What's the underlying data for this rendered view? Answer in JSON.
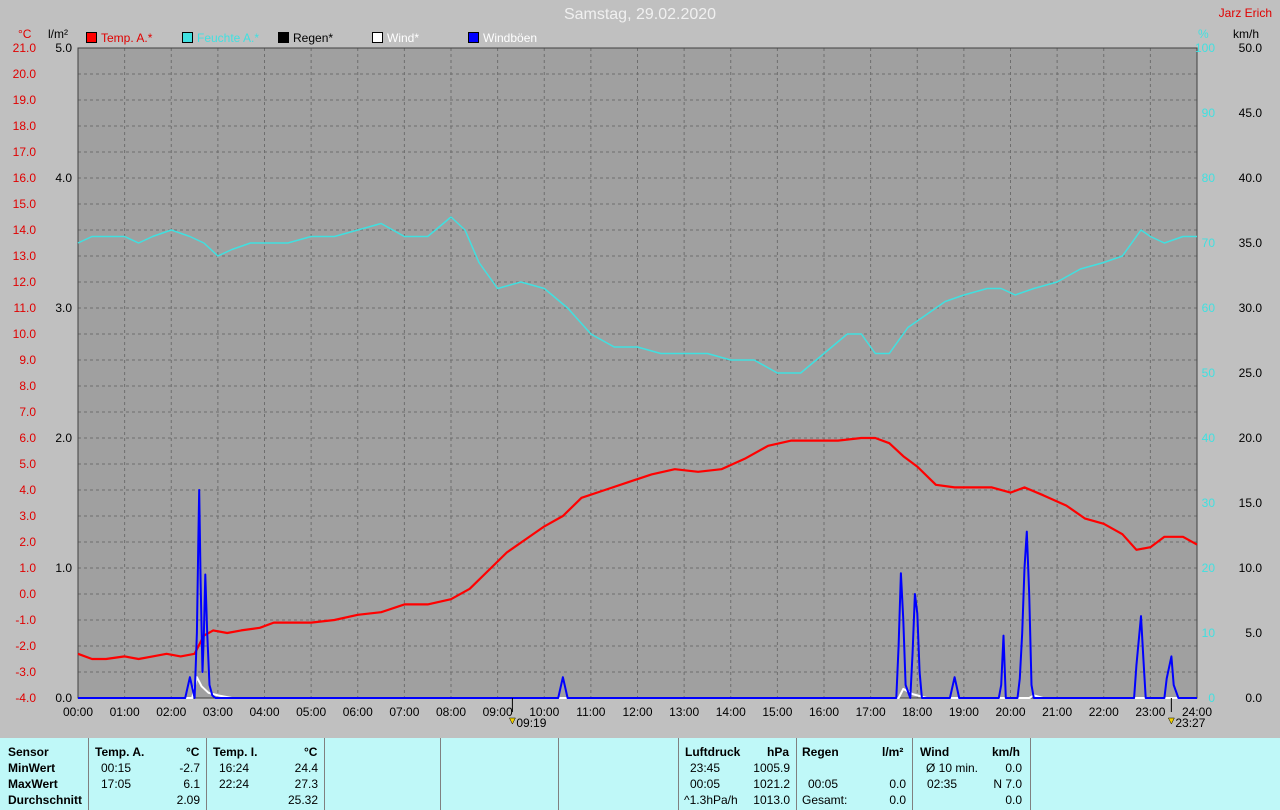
{
  "title": "Samstag, 29.02.2020",
  "author": "Jarz Erich",
  "legend": [
    {
      "label": "Temp. A.*",
      "color": "#ff0000"
    },
    {
      "label": "Feuchte A.*",
      "color": "#40e0e0"
    },
    {
      "label": "Regen*",
      "color": "#000000"
    },
    {
      "label": "Wind*",
      "color": "#ffffff"
    },
    {
      "label": "Windböen",
      "color": "#0000ff"
    }
  ],
  "units": {
    "temp": "°C",
    "rain": "l/m²",
    "hum": "%",
    "wind": "km/h"
  },
  "markers": {
    "sunrise": "09:19",
    "sunset": "23:27"
  },
  "chart_data": {
    "type": "line",
    "x_ticks": [
      "00:00",
      "01:00",
      "02:00",
      "03:00",
      "04:00",
      "05:00",
      "06:00",
      "07:00",
      "08:00",
      "09:00",
      "10:00",
      "11:00",
      "12:00",
      "13:00",
      "14:00",
      "15:00",
      "16:00",
      "17:00",
      "18:00",
      "19:00",
      "20:00",
      "21:00",
      "22:00",
      "23:00",
      "24:00"
    ],
    "axes": {
      "temp": {
        "min": -4,
        "max": 21,
        "step": 1
      },
      "rain": {
        "min": 0,
        "max": 5,
        "step": 1
      },
      "hum": {
        "min": 0,
        "max": 100,
        "step": 10
      },
      "wind": {
        "min": 0,
        "max": 50,
        "step": 5
      }
    },
    "series": [
      {
        "name": "Temp. A.*",
        "axis": "temp",
        "color": "#ff0000",
        "points": [
          [
            0.0,
            -2.3
          ],
          [
            0.3,
            -2.5
          ],
          [
            0.6,
            -2.5
          ],
          [
            1.0,
            -2.4
          ],
          [
            1.3,
            -2.5
          ],
          [
            1.6,
            -2.4
          ],
          [
            1.9,
            -2.3
          ],
          [
            2.2,
            -2.4
          ],
          [
            2.5,
            -2.3
          ],
          [
            2.7,
            -1.6
          ],
          [
            2.9,
            -1.4
          ],
          [
            3.2,
            -1.5
          ],
          [
            3.5,
            -1.4
          ],
          [
            3.9,
            -1.3
          ],
          [
            4.2,
            -1.1
          ],
          [
            4.6,
            -1.1
          ],
          [
            5.0,
            -1.1
          ],
          [
            5.5,
            -1.0
          ],
          [
            6.0,
            -0.8
          ],
          [
            6.5,
            -0.7
          ],
          [
            7.0,
            -0.4
          ],
          [
            7.5,
            -0.4
          ],
          [
            8.0,
            -0.2
          ],
          [
            8.4,
            0.2
          ],
          [
            8.8,
            0.9
          ],
          [
            9.2,
            1.6
          ],
          [
            9.6,
            2.1
          ],
          [
            10.0,
            2.6
          ],
          [
            10.4,
            3.0
          ],
          [
            10.8,
            3.7
          ],
          [
            11.3,
            4.0
          ],
          [
            11.8,
            4.3
          ],
          [
            12.3,
            4.6
          ],
          [
            12.8,
            4.8
          ],
          [
            13.3,
            4.7
          ],
          [
            13.8,
            4.8
          ],
          [
            14.3,
            5.2
          ],
          [
            14.8,
            5.7
          ],
          [
            15.3,
            5.9
          ],
          [
            15.8,
            5.9
          ],
          [
            16.3,
            5.9
          ],
          [
            16.8,
            6.0
          ],
          [
            17.1,
            6.0
          ],
          [
            17.4,
            5.8
          ],
          [
            17.7,
            5.3
          ],
          [
            18.0,
            4.9
          ],
          [
            18.4,
            4.2
          ],
          [
            18.8,
            4.1
          ],
          [
            19.2,
            4.1
          ],
          [
            19.6,
            4.1
          ],
          [
            20.0,
            3.9
          ],
          [
            20.3,
            4.1
          ],
          [
            20.7,
            3.8
          ],
          [
            21.2,
            3.4
          ],
          [
            21.6,
            2.9
          ],
          [
            22.0,
            2.7
          ],
          [
            22.4,
            2.3
          ],
          [
            22.7,
            1.7
          ],
          [
            23.0,
            1.8
          ],
          [
            23.3,
            2.2
          ],
          [
            23.7,
            2.2
          ],
          [
            24.0,
            1.9
          ]
        ]
      },
      {
        "name": "Feuchte A.*",
        "axis": "hum",
        "color": "#40e0e0",
        "points": [
          [
            0.0,
            70
          ],
          [
            0.3,
            71
          ],
          [
            0.6,
            71
          ],
          [
            1.0,
            71
          ],
          [
            1.3,
            70
          ],
          [
            1.6,
            71
          ],
          [
            2.0,
            72
          ],
          [
            2.4,
            71
          ],
          [
            2.7,
            70
          ],
          [
            3.0,
            68
          ],
          [
            3.3,
            69
          ],
          [
            3.7,
            70
          ],
          [
            4.0,
            70
          ],
          [
            4.5,
            70
          ],
          [
            5.0,
            71
          ],
          [
            5.5,
            71
          ],
          [
            6.0,
            72
          ],
          [
            6.5,
            73
          ],
          [
            7.0,
            71
          ],
          [
            7.5,
            71
          ],
          [
            8.0,
            74
          ],
          [
            8.3,
            72
          ],
          [
            8.6,
            67
          ],
          [
            9.0,
            63
          ],
          [
            9.5,
            64
          ],
          [
            10.0,
            63
          ],
          [
            10.5,
            60
          ],
          [
            11.0,
            56
          ],
          [
            11.5,
            54
          ],
          [
            12.0,
            54
          ],
          [
            12.5,
            53
          ],
          [
            13.0,
            53
          ],
          [
            13.5,
            53
          ],
          [
            14.0,
            52
          ],
          [
            14.5,
            52
          ],
          [
            15.0,
            50
          ],
          [
            15.5,
            50
          ],
          [
            16.0,
            53
          ],
          [
            16.5,
            56
          ],
          [
            16.8,
            56
          ],
          [
            17.1,
            53
          ],
          [
            17.4,
            53
          ],
          [
            17.8,
            57
          ],
          [
            18.2,
            59
          ],
          [
            18.6,
            61
          ],
          [
            19.0,
            62
          ],
          [
            19.5,
            63
          ],
          [
            19.8,
            63
          ],
          [
            20.1,
            62
          ],
          [
            20.5,
            63
          ],
          [
            21.0,
            64
          ],
          [
            21.5,
            66
          ],
          [
            22.0,
            67
          ],
          [
            22.4,
            68
          ],
          [
            22.8,
            72
          ],
          [
            23.0,
            71
          ],
          [
            23.3,
            70
          ],
          [
            23.7,
            71
          ],
          [
            24.0,
            71
          ]
        ]
      },
      {
        "name": "Wind*",
        "axis": "wind",
        "color": "#ffffff",
        "points": [
          [
            0.0,
            0
          ],
          [
            2.45,
            0
          ],
          [
            2.55,
            1.6
          ],
          [
            2.65,
            0.9
          ],
          [
            2.8,
            0.4
          ],
          [
            3.0,
            0.2
          ],
          [
            3.3,
            0
          ],
          [
            17.6,
            0
          ],
          [
            17.7,
            0.7
          ],
          [
            17.9,
            0.3
          ],
          [
            18.2,
            0
          ],
          [
            20.4,
            0
          ],
          [
            20.5,
            0.2
          ],
          [
            20.7,
            0
          ],
          [
            24.0,
            0
          ]
        ]
      },
      {
        "name": "Windböen",
        "axis": "wind",
        "color": "#0000ff",
        "points": [
          [
            0.0,
            0
          ],
          [
            2.3,
            0
          ],
          [
            2.4,
            1.6
          ],
          [
            2.5,
            0
          ],
          [
            2.55,
            5.0
          ],
          [
            2.58,
            12.0
          ],
          [
            2.6,
            16.0
          ],
          [
            2.63,
            9.0
          ],
          [
            2.67,
            2.0
          ],
          [
            2.7,
            5.0
          ],
          [
            2.73,
            9.5
          ],
          [
            2.77,
            5.0
          ],
          [
            2.82,
            1.0
          ],
          [
            2.88,
            0.2
          ],
          [
            2.95,
            0
          ],
          [
            10.3,
            0
          ],
          [
            10.4,
            1.6
          ],
          [
            10.5,
            0
          ],
          [
            17.55,
            0
          ],
          [
            17.6,
            4.0
          ],
          [
            17.65,
            9.6
          ],
          [
            17.7,
            6.0
          ],
          [
            17.75,
            1.0
          ],
          [
            17.85,
            0
          ],
          [
            17.9,
            3.5
          ],
          [
            17.95,
            8.0
          ],
          [
            18.0,
            6.5
          ],
          [
            18.05,
            2.0
          ],
          [
            18.1,
            0
          ],
          [
            18.7,
            0
          ],
          [
            18.8,
            1.6
          ],
          [
            18.9,
            0
          ],
          [
            19.75,
            0
          ],
          [
            19.8,
            1.0
          ],
          [
            19.85,
            4.8
          ],
          [
            19.9,
            0
          ],
          [
            20.15,
            0
          ],
          [
            20.2,
            1.5
          ],
          [
            20.25,
            5.0
          ],
          [
            20.3,
            10.0
          ],
          [
            20.35,
            12.8
          ],
          [
            20.4,
            8.0
          ],
          [
            20.45,
            1.0
          ],
          [
            20.5,
            0
          ],
          [
            22.65,
            0
          ],
          [
            22.7,
            2.5
          ],
          [
            22.8,
            6.3
          ],
          [
            22.85,
            3.0
          ],
          [
            22.9,
            0
          ],
          [
            23.3,
            0
          ],
          [
            23.35,
            1.5
          ],
          [
            23.45,
            3.2
          ],
          [
            23.5,
            1.0
          ],
          [
            23.6,
            0
          ],
          [
            24.0,
            0
          ]
        ]
      }
    ]
  },
  "summary": {
    "header": {
      "sensor": "Sensor",
      "tempa": "Temp. A.",
      "tempa_unit": "°C",
      "tempi": "Temp. I.",
      "tempi_unit": "°C",
      "pressure": "Luftdruck",
      "pressure_unit": "hPa",
      "rain": "Regen",
      "rain_unit": "l/m²",
      "wind": "Wind",
      "wind_unit": "km/h"
    },
    "rows": [
      {
        "label": "MinWert",
        "tempa_t": "00:15",
        "tempa_v": "-2.7",
        "tempi_t": "16:24",
        "tempi_v": "24.4",
        "press_t": "23:45",
        "press_v": "1005.9",
        "rain_t": "",
        "rain_v": "",
        "wind_t": "Ø 10 min.",
        "wind_v": "0.0"
      },
      {
        "label": "MaxWert",
        "tempa_t": "17:05",
        "tempa_v": "6.1",
        "tempi_t": "22:24",
        "tempi_v": "27.3",
        "press_t": "00:05",
        "press_v": "1021.2",
        "rain_t": "00:05",
        "rain_v": "0.0",
        "wind_t": "02:35",
        "wind_v": "N 7.0"
      },
      {
        "label": "Durchschnitt",
        "tempa_t": "",
        "tempa_v": "2.09",
        "tempi_t": "",
        "tempi_v": "25.32",
        "press_t": "^1.3hPa/h",
        "press_v": "1013.0",
        "rain_t": "Gesamt:",
        "rain_v": "0.0",
        "wind_t": "",
        "wind_v": "0.0"
      }
    ]
  }
}
